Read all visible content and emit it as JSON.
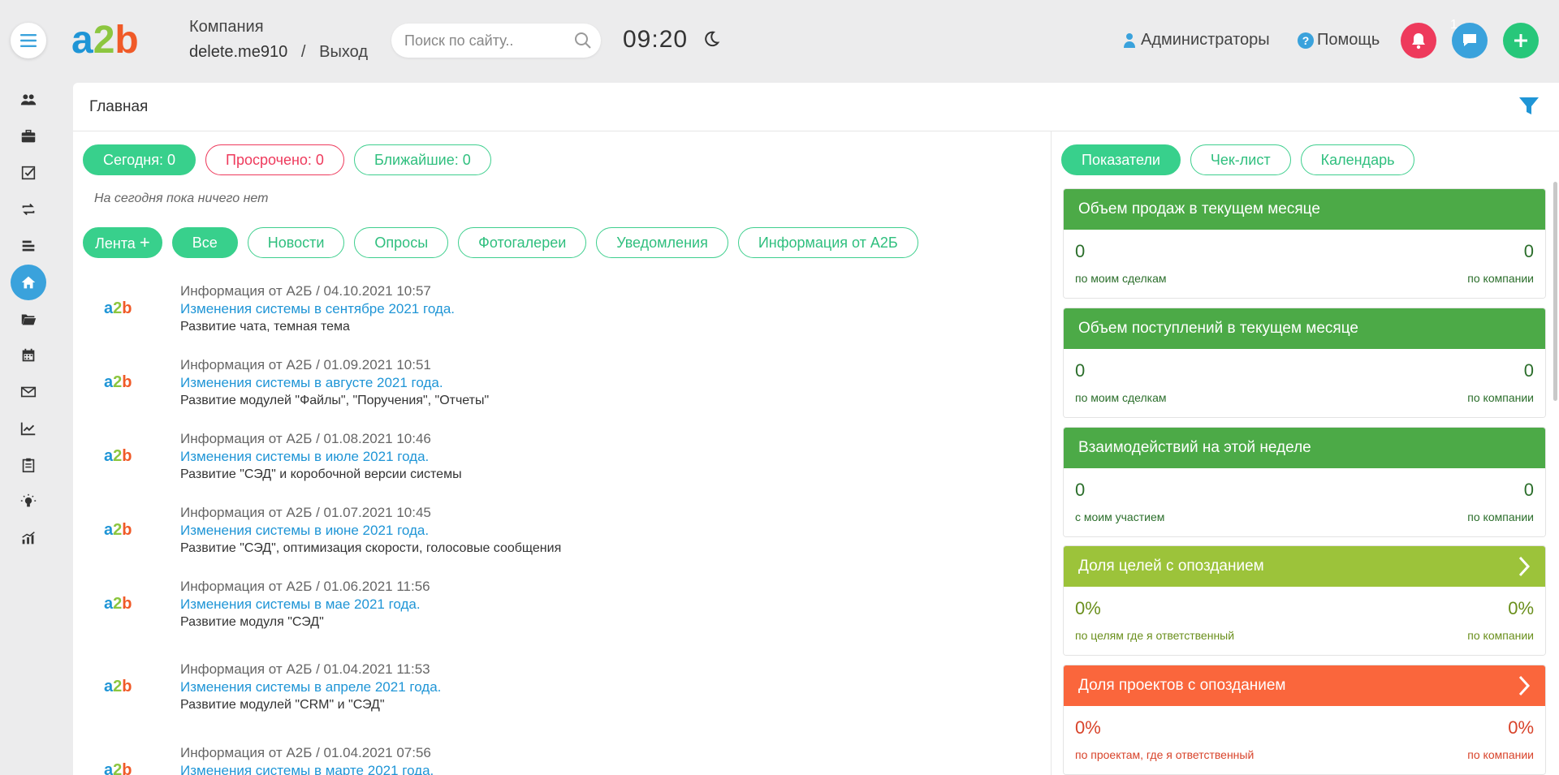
{
  "header": {
    "company_label": "Компания",
    "username": "delete.me910",
    "separator": "/",
    "logout": "Выход",
    "search_placeholder": "Поиск по сайту..",
    "time": "09:20",
    "admins": "Администраторы",
    "help": "Помощь",
    "chat_badge": "1",
    "logo_letters": [
      "a",
      "2",
      "b"
    ]
  },
  "page": {
    "title": "Главная"
  },
  "tasks": {
    "today": "Сегодня: 0",
    "overdue": "Просрочено: 0",
    "upcoming": "Ближайшие: 0",
    "empty_note": "На сегодня пока ничего нет"
  },
  "feed_tabs": {
    "feed": "Лента",
    "feed_plus": "+",
    "all": "Все",
    "news": "Новости",
    "polls": "Опросы",
    "galleries": "Фотогалереи",
    "notifications": "Уведомления",
    "info": "Информация от А2Б"
  },
  "feed": [
    {
      "meta": "Информация от А2Б / 04.10.2021 10:57",
      "title": "Изменения системы в сентябре 2021 года.",
      "desc": "Развитие чата, темная тема"
    },
    {
      "meta": "Информация от А2Б / 01.09.2021 10:51",
      "title": "Изменения системы в августе 2021 года.",
      "desc": "Развитие модулей \"Файлы\", \"Поручения\", \"Отчеты\""
    },
    {
      "meta": "Информация от А2Б / 01.08.2021 10:46",
      "title": "Изменения системы в июле 2021 года.",
      "desc": "Развитие \"СЭД\" и коробочной версии системы"
    },
    {
      "meta": "Информация от А2Б / 01.07.2021 10:45",
      "title": "Изменения системы в июне 2021 года.",
      "desc": "Развитие \"СЭД\", оптимизация скорости, голосовые сообщения"
    },
    {
      "meta": "Информация от А2Б / 01.06.2021 11:56",
      "title": "Изменения системы в мае 2021 года.",
      "desc": "Развитие модуля \"СЭД\""
    },
    {
      "meta": "Информация от А2Б / 01.04.2021 11:53",
      "title": "Изменения системы в апреле 2021 года.",
      "desc": "Развитие модулей \"CRM\" и \"СЭД\""
    },
    {
      "meta": "Информация от А2Б / 01.04.2021 07:56",
      "title": "Изменения системы в марте 2021 года.",
      "desc": ""
    }
  ],
  "right_tabs": {
    "indicators": "Показатели",
    "checklist": "Чек-лист",
    "calendar": "Календарь"
  },
  "cards": [
    {
      "title": "Объем продаж в текущем месяце",
      "left_value": "0",
      "right_value": "0",
      "left_sub": "по моим сделкам",
      "right_sub": "по компании",
      "color": "#4caa47",
      "text_color": "#2b6e2b",
      "has_arrow": false
    },
    {
      "title": "Объем поступлений в текущем месяце",
      "left_value": "0",
      "right_value": "0",
      "left_sub": "по моим сделкам",
      "right_sub": "по компании",
      "color": "#4caa47",
      "text_color": "#2b6e2b",
      "has_arrow": false
    },
    {
      "title": "Взаимодействий на этой неделе",
      "left_value": "0",
      "right_value": "0",
      "left_sub": "с моим участием",
      "right_sub": "по компании",
      "color": "#4caa47",
      "text_color": "#2b6e2b",
      "has_arrow": false
    },
    {
      "title": "Доля целей с опозданием",
      "left_value": "0%",
      "right_value": "0%",
      "left_sub": "по целям где я ответственный",
      "right_sub": "по компании",
      "color": "#9cc33a",
      "text_color": "#6a8f1c",
      "has_arrow": true
    },
    {
      "title": "Доля проектов с опозданием",
      "left_value": "0%",
      "right_value": "0%",
      "left_sub": "по проектам, где я ответственный",
      "right_sub": "по компании",
      "color": "#fa663c",
      "text_color": "#d8432a",
      "has_arrow": true
    }
  ],
  "colors": {
    "accent_green": "#38d08c",
    "accent_blue": "#3aa2dc",
    "alert_red": "#ee3a5c",
    "logo_blue": "#1f95d6",
    "logo_green": "#8cc63f",
    "logo_orange": "#f05a28"
  },
  "sidebar_icons": [
    "users-icon",
    "briefcase-icon",
    "checkbox-icon",
    "repeat-icon",
    "layers-icon",
    "home-icon",
    "folder-icon",
    "calendar-icon",
    "mail-icon",
    "chart-line-icon",
    "clipboard-icon",
    "lightbulb-icon",
    "analytics-icon"
  ]
}
